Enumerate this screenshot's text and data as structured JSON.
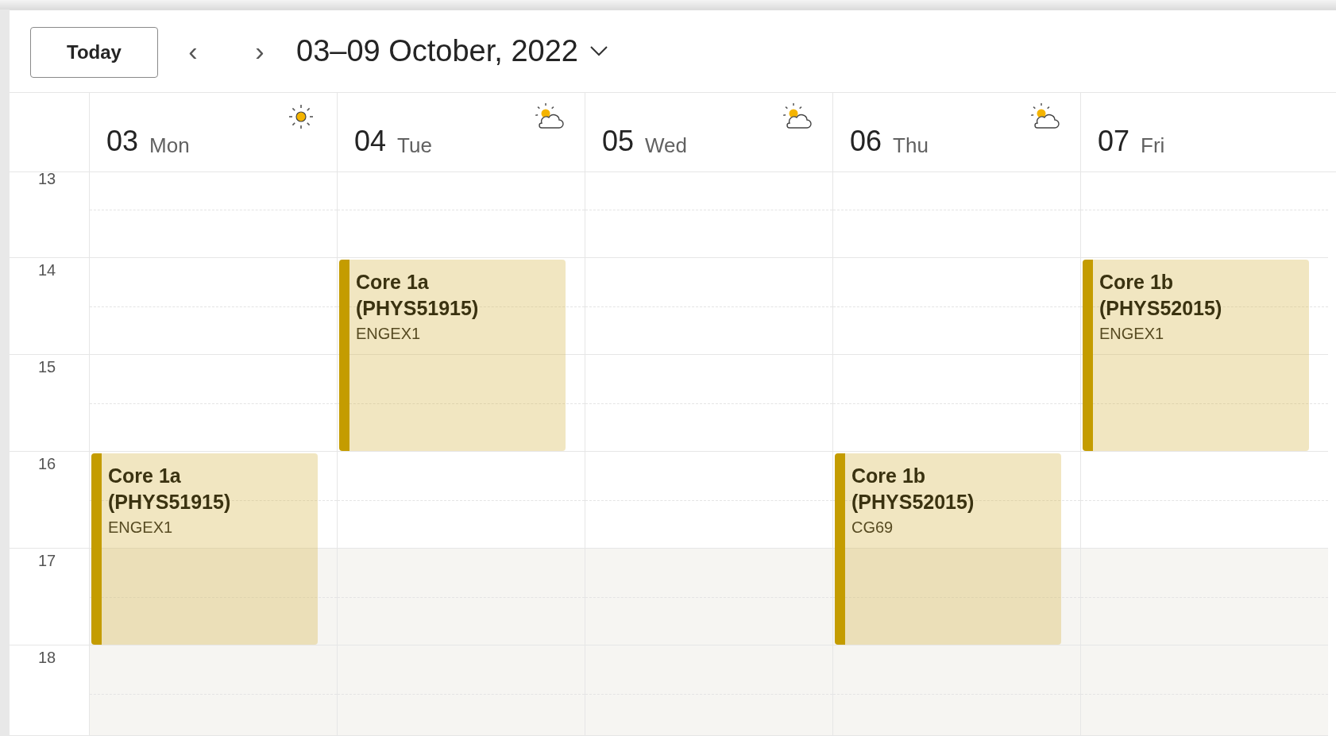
{
  "toolbar": {
    "today_button": "Today",
    "prev": "‹",
    "next": "›",
    "date_range": "03–09 October, 2022"
  },
  "hours": [
    {
      "label": "13",
      "working": true
    },
    {
      "label": "14",
      "working": true
    },
    {
      "label": "15",
      "working": true
    },
    {
      "label": "16",
      "working": true
    },
    {
      "label": "17",
      "working": false
    },
    {
      "label": "18",
      "working": false
    }
  ],
  "days": [
    {
      "number": "03",
      "weekday": "Mon",
      "weather": {
        "kind": "sunny"
      },
      "slots": [
        {
          "kind": "free"
        },
        {
          "kind": "free"
        },
        {
          "kind": "free"
        },
        {
          "kind": "event",
          "title": "Core 1a (PHYS51915)",
          "location": "ENGEX1"
        }
      ]
    },
    {
      "number": "04",
      "weekday": "Tue",
      "weather": {
        "kind": "partly-cloudy"
      },
      "slots": [
        {
          "kind": "free"
        },
        {
          "kind": "event",
          "title": "Core 1a (PHYS51915)",
          "location": "ENGEX1"
        }
      ]
    },
    {
      "number": "05",
      "weekday": "Wed",
      "weather": {
        "kind": "partly-cloudy"
      }
    },
    {
      "number": "06",
      "weekday": "Thu",
      "weather": {
        "kind": "partly-cloudy"
      },
      "slots": [
        {
          "kind": "free"
        },
        {
          "kind": "free"
        },
        {
          "kind": "free"
        },
        {
          "kind": "event",
          "title": "Core 1b (PHYS52015)",
          "location": "CG69"
        }
      ]
    },
    {
      "number": "07",
      "weekday": "Fri",
      "slots": [
        {
          "kind": "free"
        },
        {
          "kind": "event",
          "title": "Core 1b (PHYS52015)",
          "location": "ENGEX1"
        }
      ]
    }
  ]
}
